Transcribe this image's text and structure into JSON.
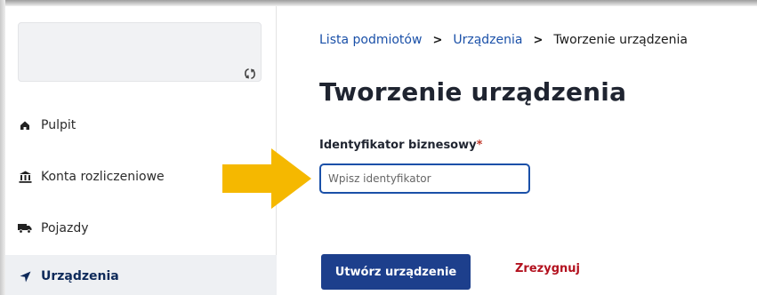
{
  "sidebar": {
    "items": [
      {
        "label": "Pulpit",
        "icon": "home-icon"
      },
      {
        "label": "Konta rozliczeniowe",
        "icon": "bank-icon"
      },
      {
        "label": "Pojazdy",
        "icon": "truck-icon"
      },
      {
        "label": "Urządzenia",
        "icon": "location-arrow-icon",
        "active": true
      }
    ]
  },
  "breadcrumb": {
    "items": [
      "Lista podmiotów",
      "Urządzenia",
      "Tworzenie urządzenia"
    ]
  },
  "page": {
    "title": "Tworzenie urządzenia"
  },
  "form": {
    "identifier_label": "Identyfikator biznesowy",
    "required_marker": "*",
    "identifier_placeholder": "Wpisz identyfikator",
    "identifier_value": ""
  },
  "actions": {
    "create_label": "Utwórz urządzenie",
    "cancel_label": "Zrezygnuj"
  },
  "colors": {
    "accent": "#1d3f8c",
    "link": "#1a50a8",
    "danger": "#b3121f",
    "annotation_arrow": "#f5b800"
  }
}
